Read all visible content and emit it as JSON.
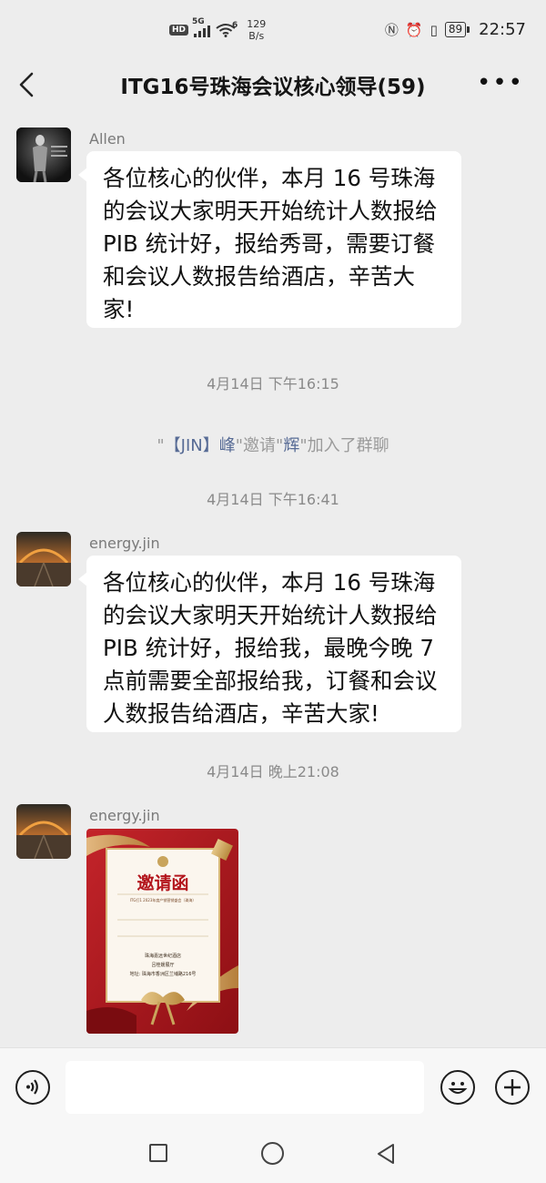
{
  "status_bar": {
    "hd": "HD",
    "net_5g": "5G",
    "wifi_6": "6",
    "speed_value": "129",
    "speed_unit": "B/s",
    "battery": "89",
    "time": "22:57"
  },
  "header": {
    "title": "ITG16号珠海会议核心领导(59)"
  },
  "chat": {
    "msg1": {
      "sender": "Allen",
      "text": "各位核心的伙伴，本月 16 号珠海的会议大家明天开始统计人数报给 PIB 统计好，报给秀哥，需要订餐和会议人数报告给酒店，辛苦大家!"
    },
    "time1": "4月14日 下午16:15",
    "system": {
      "open_quote": "\"",
      "inviter": "【JIN】峰",
      "mid": "\"邀请\"",
      "invitee": "辉",
      "end": "\"加入了群聊"
    },
    "time2": "4月14日 下午16:41",
    "msg2": {
      "sender": "energy.jin",
      "text": "各位核心的伙伴，本月 16 号珠海的会议大家明天开始统计人数报给 PIB 统计好，报给我，最晚今晚 7 点前需要全部报给我，订餐和会议人数报告给酒店，辛苦大家!"
    },
    "time3": "4月14日 晚上21:08",
    "msg3": {
      "sender": "energy.jin",
      "image": {
        "title": "邀请函",
        "subtitle": "ITG打1 2023年度产销营销盛会（珠海）",
        "venue": "珠海嘉远世纪酒店",
        "hall": "吕桂媛展厅",
        "address": "地址: 珠海市香洲区兰埔路216号"
      }
    }
  },
  "input": {
    "placeholder": ""
  },
  "colors": {
    "background": "#ededed",
    "bubble": "#ffffff",
    "name_link": "#576b95",
    "invite_red": "#b3151c"
  }
}
